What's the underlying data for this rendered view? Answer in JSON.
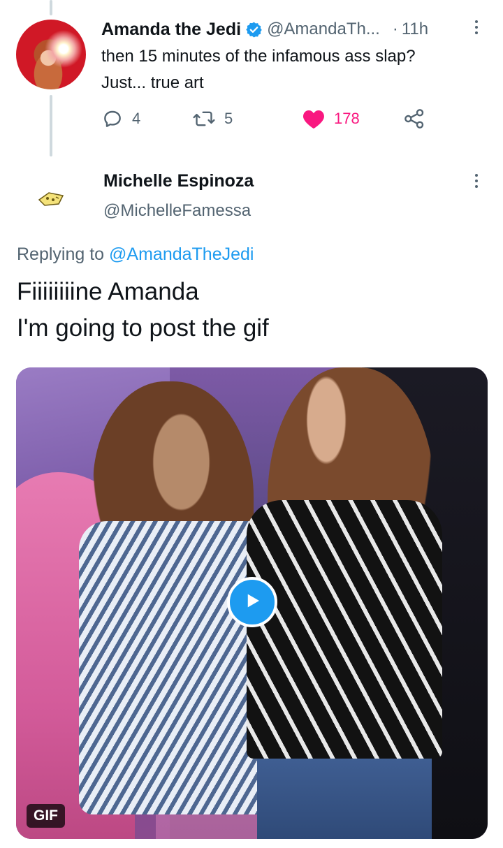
{
  "tweet1": {
    "name": "Amanda the Jedi",
    "handle": "@AmandaTh...",
    "separator": "·",
    "time": "11h",
    "text_line1": "then 15 minutes of the infamous ass slap?",
    "text_line2": "Just... true art",
    "replies": "4",
    "retweets": "5",
    "likes": "178",
    "liked": true
  },
  "tweet2": {
    "name": "Michelle Espinoza",
    "handle": "@MichelleFamessa",
    "replying_prefix": "Replying to",
    "replying_mention": "@AmandaTheJedi",
    "text_line1": "Fiiiiiiiine Amanda",
    "text_line2": "I'm going to post the gif",
    "media_badge": "GIF"
  },
  "colors": {
    "accent": "#1d9bf0",
    "like": "#f91880",
    "secondary_text": "#536471",
    "thread_line": "#cfd9de"
  },
  "icons": {
    "verified": "verified-badge-icon",
    "reply": "reply-icon",
    "retweet": "retweet-icon",
    "like": "heart-icon",
    "share": "share-icon",
    "more": "more-vertical-icon",
    "play": "play-icon"
  }
}
